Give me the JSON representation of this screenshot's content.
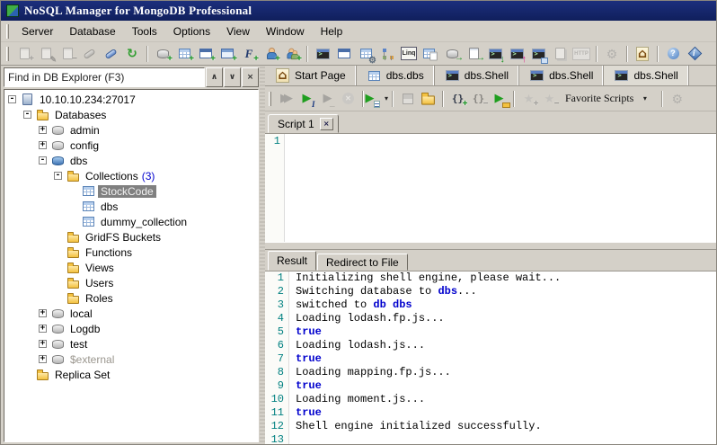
{
  "window": {
    "title": "NoSQL Manager for MongoDB Professional"
  },
  "menu": {
    "items": [
      "Server",
      "Database",
      "Tools",
      "Options",
      "View",
      "Window",
      "Help"
    ]
  },
  "toolbar": {
    "groups": [
      [
        {
          "name": "register-server-add-button",
          "icon": "server-add-icon",
          "disabled": true
        },
        {
          "name": "register-server-edit-button",
          "icon": "server-edit-icon",
          "disabled": true
        },
        {
          "name": "register-server-remove-button",
          "icon": "server-remove-icon",
          "disabled": true
        },
        {
          "name": "connect-button",
          "icon": "plug-connect-icon",
          "disabled": true
        },
        {
          "name": "disconnect-button",
          "icon": "plug-disconnect-icon",
          "disabled": false
        },
        {
          "name": "refresh-button",
          "icon": "refresh-icon",
          "disabled": false
        }
      ],
      [
        {
          "name": "add-database-button",
          "icon": "database-add-icon",
          "disabled": false
        },
        {
          "name": "add-collection-button",
          "icon": "collection-add-icon",
          "disabled": false
        },
        {
          "name": "add-view-button",
          "icon": "view-add-icon",
          "disabled": false
        },
        {
          "name": "add-gridfs-bucket-button",
          "icon": "window-add-icon",
          "disabled": false
        },
        {
          "name": "add-function-button",
          "icon": "function-add-icon",
          "disabled": false
        },
        {
          "name": "add-user-button",
          "icon": "user-add-icon",
          "disabled": false
        },
        {
          "name": "add-role-button",
          "icon": "users-add-icon",
          "disabled": false
        }
      ],
      [
        {
          "name": "open-shell-button",
          "icon": "console-icon",
          "disabled": false
        },
        {
          "name": "open-document-viewer-button",
          "icon": "window-icon",
          "disabled": false
        },
        {
          "name": "table-settings-button",
          "icon": "grid-gear-icon",
          "disabled": false
        },
        {
          "name": "schema-analyzer-button",
          "icon": "tree-icon",
          "disabled": false
        },
        {
          "name": "linq-query-button",
          "icon": "linq-icon",
          "disabled": false
        },
        {
          "name": "copy-collection-button",
          "icon": "table-copy-icon",
          "disabled": false
        },
        {
          "name": "export-database-button",
          "icon": "database-export-icon",
          "disabled": false
        },
        {
          "name": "export-documents-button",
          "icon": "page-export-icon",
          "disabled": false
        },
        {
          "name": "console-import-button",
          "icon": "console-import-icon",
          "disabled": false
        },
        {
          "name": "console-export-button",
          "icon": "console-export-icon",
          "disabled": false
        },
        {
          "name": "console-grid-button",
          "icon": "console-grid-icon",
          "disabled": false
        },
        {
          "name": "copy-button",
          "icon": "copy-icon",
          "disabled": true
        },
        {
          "name": "http-button",
          "icon": "http-icon",
          "disabled": true
        }
      ],
      [
        {
          "name": "settings-button",
          "icon": "gear-icon",
          "disabled": true
        }
      ],
      [
        {
          "name": "home-button",
          "icon": "home-icon",
          "disabled": false
        }
      ],
      [
        {
          "name": "help-button",
          "icon": "help-icon",
          "disabled": false
        },
        {
          "name": "about-button",
          "icon": "about-icon",
          "disabled": false
        }
      ]
    ]
  },
  "explorer": {
    "search": {
      "text": "Find in DB Explorer (F3)",
      "buttons": [
        {
          "name": "search-previous-button",
          "icon": "chevron-up-icon"
        },
        {
          "name": "search-next-button",
          "icon": "chevron-down-icon"
        },
        {
          "name": "search-close-button",
          "icon": "close-icon"
        }
      ]
    },
    "tree": [
      {
        "label": "10.10.10.234:27017",
        "level": 0,
        "expand": "-",
        "icon": "server-icon"
      },
      {
        "label": "Databases",
        "level": 1,
        "expand": "-",
        "icon": "folder-icon"
      },
      {
        "label": "admin",
        "level": 2,
        "expand": "+",
        "icon": "database-gray-icon"
      },
      {
        "label": "config",
        "level": 2,
        "expand": "+",
        "icon": "database-gray-icon"
      },
      {
        "label": "dbs",
        "level": 2,
        "expand": "-",
        "icon": "database-blue-icon"
      },
      {
        "label": "Collections",
        "suffix": "(3)",
        "level": 3,
        "expand": "-",
        "icon": "folder-icon"
      },
      {
        "label": "StockCode",
        "level": 4,
        "icon": "collection-icon",
        "selected": true
      },
      {
        "label": "dbs",
        "level": 4,
        "icon": "collection-icon"
      },
      {
        "label": "dummy_collection",
        "level": 4,
        "icon": "collection-icon"
      },
      {
        "label": "GridFS Buckets",
        "level": 3,
        "icon": "folder-icon"
      },
      {
        "label": "Functions",
        "level": 3,
        "icon": "folder-icon"
      },
      {
        "label": "Views",
        "level": 3,
        "icon": "folder-icon"
      },
      {
        "label": "Users",
        "level": 3,
        "icon": "folder-icon"
      },
      {
        "label": "Roles",
        "level": 3,
        "icon": "folder-icon"
      },
      {
        "label": "local",
        "level": 2,
        "expand": "+",
        "icon": "database-gray-icon"
      },
      {
        "label": "Logdb",
        "level": 2,
        "expand": "+",
        "icon": "database-gray-icon"
      },
      {
        "label": "test",
        "level": 2,
        "expand": "+",
        "icon": "database-gray-icon"
      },
      {
        "label": "$external",
        "level": 2,
        "expand": "+",
        "icon": "database-gray-icon",
        "dim": true
      },
      {
        "label": "Replica Set",
        "level": 1,
        "icon": "folder-icon"
      }
    ]
  },
  "doc_tabs": {
    "items": [
      {
        "name": "tab-start-page",
        "label": "Start Page",
        "icon": "home-icon",
        "active": false
      },
      {
        "name": "tab-dbs-dbs",
        "label": "dbs.dbs",
        "icon": "collection-icon",
        "active": false
      },
      {
        "name": "tab-dbs-shell-1",
        "label": "dbs.Shell",
        "icon": "console-icon",
        "active": false
      },
      {
        "name": "tab-dbs-shell-2",
        "label": "dbs.Shell",
        "icon": "console-icon",
        "active": false
      },
      {
        "name": "tab-dbs-shell-3",
        "label": "dbs.Shell",
        "icon": "console-icon",
        "active": true
      }
    ]
  },
  "shell_toolbar": {
    "favorite_label": "Favorite Scripts",
    "groups": [
      [
        {
          "name": "execute-all-button",
          "icon": "play-double-icon",
          "disabled": true
        },
        {
          "name": "execute-button",
          "icon": "play-execute-icon",
          "disabled": false
        },
        {
          "name": "execute-to-cursor-button",
          "icon": "play-line-icon",
          "disabled": true
        },
        {
          "name": "stop-button",
          "icon": "stop-icon",
          "disabled": true
        }
      ],
      [
        {
          "name": "execute-options-button",
          "icon": "play-list-icon",
          "disabled": false,
          "caret": true
        }
      ],
      [
        {
          "name": "save-script-button",
          "icon": "floppy-icon",
          "disabled": true
        },
        {
          "name": "open-script-button",
          "icon": "folder-open-icon",
          "disabled": false
        }
      ],
      [
        {
          "name": "insert-document-button",
          "icon": "braces-add-icon",
          "disabled": false
        },
        {
          "name": "remove-document-button",
          "icon": "braces-remove-icon",
          "disabled": true
        },
        {
          "name": "run-script-file-button",
          "icon": "play-folder-icon",
          "disabled": false
        }
      ],
      [
        {
          "name": "add-favorite-button",
          "icon": "star-add-icon",
          "disabled": true
        },
        {
          "name": "remove-favorite-button",
          "icon": "star-remove-icon",
          "disabled": true
        },
        {
          "name": "favorite-scripts-dropdown",
          "label_key": "favorite_label",
          "caret": true
        }
      ],
      [
        {
          "name": "shell-settings-button",
          "icon": "gear-icon",
          "disabled": true
        }
      ]
    ]
  },
  "script_tabs": [
    {
      "name": "tab-script-1",
      "label": "Script 1",
      "closable": true
    }
  ],
  "editor": {
    "lines": [
      {
        "n": "1"
      }
    ]
  },
  "result_tabs": [
    {
      "name": "tab-result",
      "label": "Result",
      "active": true
    },
    {
      "name": "tab-redirect-to-file",
      "label": "Redirect to File",
      "active": false
    }
  ],
  "console": {
    "lines": [
      {
        "n": "1",
        "segs": [
          {
            "t": "Initializing shell engine, please wait...",
            "c": "black"
          }
        ]
      },
      {
        "n": "2",
        "segs": [
          {
            "t": "Switching database to ",
            "c": "black"
          },
          {
            "t": "dbs",
            "c": "blue"
          },
          {
            "t": "...",
            "c": "black"
          }
        ]
      },
      {
        "n": "3",
        "segs": [
          {
            "t": "switched to ",
            "c": "black"
          },
          {
            "t": "db dbs",
            "c": "blue"
          }
        ]
      },
      {
        "n": "4",
        "segs": [
          {
            "t": "Loading lodash.fp.js...",
            "c": "black"
          }
        ]
      },
      {
        "n": "5",
        "segs": [
          {
            "t": "true",
            "c": "blue"
          }
        ]
      },
      {
        "n": "6",
        "segs": [
          {
            "t": "Loading lodash.js...",
            "c": "black"
          }
        ]
      },
      {
        "n": "7",
        "segs": [
          {
            "t": "true",
            "c": "blue"
          }
        ]
      },
      {
        "n": "8",
        "segs": [
          {
            "t": "Loading mapping.fp.js...",
            "c": "black"
          }
        ]
      },
      {
        "n": "9",
        "segs": [
          {
            "t": "true",
            "c": "blue"
          }
        ]
      },
      {
        "n": "10",
        "segs": [
          {
            "t": "Loading moment.js...",
            "c": "black"
          }
        ]
      },
      {
        "n": "11",
        "segs": [
          {
            "t": "true",
            "c": "blue"
          }
        ]
      },
      {
        "n": "12",
        "segs": [
          {
            "t": "Shell engine initialized successfully.",
            "c": "black"
          }
        ]
      },
      {
        "n": "13",
        "segs": []
      }
    ]
  },
  "colors": {
    "titlebar_navy": "#14266e",
    "chrome_gray": "#d4d0c8",
    "selection_gray": "#808080",
    "console_keyword_blue": "#0000cd",
    "line_number_teal": "#008080",
    "count_blue": "#0000cd"
  }
}
